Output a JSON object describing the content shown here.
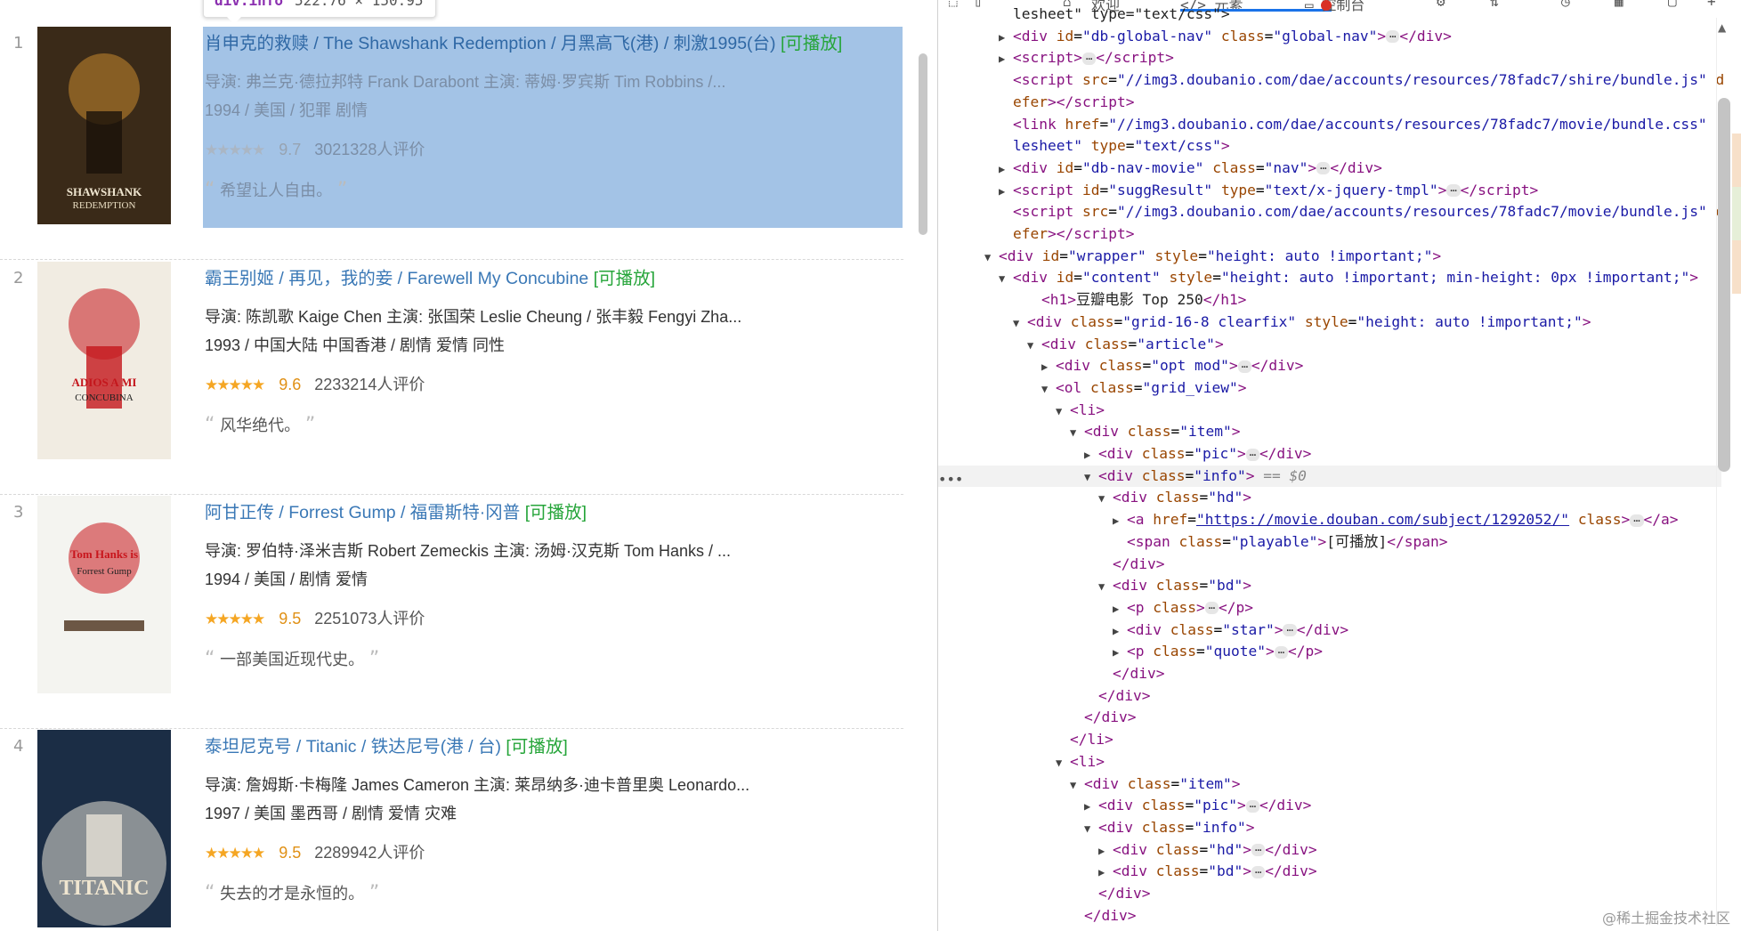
{
  "tooltip": {
    "tag": "div.info",
    "dims": "522.76 × 150.95"
  },
  "movies": [
    {
      "rank": "1",
      "title": "肖申克的救赎",
      "other": " / The Shawshank Redemption  / 月黑高飞(港) / 刺激1995(台)",
      "playable": "[可播放]",
      "director": "导演: 弗兰克·德拉邦特 Frank Darabont   主演: 蒂姆·罗宾斯 Tim Robbins /...",
      "meta": "1994 / 美国 / 犯罪 剧情",
      "stars": "★★★★★",
      "score": "9.7",
      "count": "3021328人评价",
      "quote": "希望让人自由。",
      "poster": {
        "label": "SHAWSHANK",
        "sub": "REDEMPTION",
        "bg": "#3a2a18",
        "accent": "#c7892f"
      }
    },
    {
      "rank": "2",
      "title": "霸王别姬",
      "other": " / 再见，我的妾 / Farewell My Concubine",
      "playable": "[可播放]",
      "director": "导演: 陈凯歌 Kaige Chen   主演: 张国荣 Leslie Cheung / 张丰毅 Fengyi Zha...",
      "meta": "1993 / 中国大陆 中国香港 / 剧情 爱情 同性",
      "stars": "★★★★★",
      "score": "9.6",
      "count": "2233214人评价",
      "quote": "风华绝代。",
      "poster": {
        "label": "ADIOS A MI",
        "sub": "CONCUBINA",
        "bg": "#f1ece2",
        "accent": "#c4161c"
      }
    },
    {
      "rank": "3",
      "title": "阿甘正传",
      "other": " / Forrest Gump  / 福雷斯特·冈普",
      "playable": "[可播放]",
      "director": "导演: 罗伯特·泽米吉斯 Robert Zemeckis   主演: 汤姆·汉克斯 Tom Hanks / ...",
      "meta": "1994 / 美国 / 剧情 爱情",
      "stars": "★★★★★",
      "score": "9.5",
      "count": "2251073人评价",
      "quote": "一部美国近现代史。",
      "poster": {
        "label": "Tom Hanks is",
        "sub": "Forrest Gump",
        "bg": "#f4f4f0",
        "accent": "#c8151c"
      }
    },
    {
      "rank": "4",
      "title": "泰坦尼克号",
      "other": " / Titanic  / 铁达尼号(港 / 台)",
      "playable": "[可播放]",
      "director": "导演: 詹姆斯·卡梅隆 James Cameron   主演: 莱昂纳多·迪卡普里奥 Leonardo...",
      "meta": "1997 / 美国 墨西哥 / 剧情 爱情 灾难",
      "stars": "★★★★★",
      "score": "9.5",
      "count": "2289942人评价",
      "quote": "失去的才是永恒的。",
      "poster": {
        "label": "TITANIC",
        "sub": "",
        "bg": "#1b2d45",
        "accent": "#e6e1d6"
      }
    }
  ],
  "devtools": {
    "toolbar": [
      "元素",
      "控制台"
    ],
    "lines": [
      {
        "indent": 4,
        "tri": "",
        "html": "<span class='tx'>lesheet\" type=\"text/css\"></span>"
      },
      {
        "indent": 4,
        "tri": "▶",
        "html": "<span class='tg'>&lt;div</span> <span class='an'>id</span>=<span class='av'>\"db-global-nav\"</span> <span class='an'>class</span>=<span class='av'>\"global-nav\"</span><span class='tg'>&gt;</span><span class='ell'>⋯</span><span class='tg'>&lt;/div&gt;</span>"
      },
      {
        "indent": 4,
        "tri": "▶",
        "html": "<span class='tg'>&lt;script&gt;</span><span class='ell'>⋯</span><span class='tg'>&lt;/script&gt;</span>"
      },
      {
        "indent": 4,
        "tri": "",
        "html": "<span class='tg'>&lt;script</span> <span class='an'>src</span>=<span class='av'>\"//img3.doubanio.com/dae/accounts/resources/78fadc7/shire/bundle.js\"</span> <span class='an'>d</span>"
      },
      {
        "indent": 4,
        "tri": "",
        "html": "<span class='an'>efer</span><span class='tg'>&gt;&lt;/script&gt;</span>"
      },
      {
        "indent": 4,
        "tri": "",
        "html": "<span class='tg'>&lt;link</span> <span class='an'>href</span>=<span class='av'>\"//img3.doubanio.com/dae/accounts/resources/78fadc7/movie/bundle.css\"</span> <span class='an'>r</span>"
      },
      {
        "indent": 4,
        "tri": "",
        "html": "<span class='av'>lesheet\"</span> <span class='an'>type</span>=<span class='av'>\"text/css\"</span><span class='tg'>&gt;</span>"
      },
      {
        "indent": 4,
        "tri": "▶",
        "html": "<span class='tg'>&lt;div</span> <span class='an'>id</span>=<span class='av'>\"db-nav-movie\"</span> <span class='an'>class</span>=<span class='av'>\"nav\"</span><span class='tg'>&gt;</span><span class='ell'>⋯</span><span class='tg'>&lt;/div&gt;</span>"
      },
      {
        "indent": 4,
        "tri": "▶",
        "html": "<span class='tg'>&lt;script</span> <span class='an'>id</span>=<span class='av'>\"suggResult\"</span> <span class='an'>type</span>=<span class='av'>\"text/x-jquery-tmpl\"</span><span class='tg'>&gt;</span><span class='ell'>⋯</span><span class='tg'>&lt;/script&gt;</span>"
      },
      {
        "indent": 4,
        "tri": "",
        "html": "<span class='tg'>&lt;script</span> <span class='an'>src</span>=<span class='av'>\"//img3.doubanio.com/dae/accounts/resources/78fadc7/movie/bundle.js\"</span> <span class='an'>d</span>"
      },
      {
        "indent": 4,
        "tri": "",
        "html": "<span class='an'>efer</span><span class='tg'>&gt;&lt;/script&gt;</span>"
      },
      {
        "indent": 3,
        "tri": "▼",
        "html": "<span class='tg'>&lt;div</span> <span class='an'>id</span>=<span class='av'>\"wrapper\"</span> <span class='an'>style</span>=<span class='av'>\"height: auto !important;\"</span><span class='tg'>&gt;</span>"
      },
      {
        "indent": 4,
        "tri": "▼",
        "html": "<span class='tg'>&lt;div</span> <span class='an'>id</span>=<span class='av'>\"content\"</span> <span class='an'>style</span>=<span class='av'>\"height: auto !important; min-height: 0px !important;\"</span><span class='tg'>&gt;</span>"
      },
      {
        "indent": 6,
        "tri": "",
        "html": "<span class='tg'>&lt;h1&gt;</span><span class='tx'>豆瓣电影 Top 250</span><span class='tg'>&lt;/h1&gt;</span>"
      },
      {
        "indent": 5,
        "tri": "▼",
        "html": "<span class='tg'>&lt;div</span> <span class='an'>class</span>=<span class='av'>\"grid-16-8 clearfix\"</span> <span class='an'>style</span>=<span class='av'>\"height: auto !important;\"</span><span class='tg'>&gt;</span>"
      },
      {
        "indent": 6,
        "tri": "▼",
        "html": "<span class='tg'>&lt;div</span> <span class='an'>class</span>=<span class='av'>\"article\"</span><span class='tg'>&gt;</span>"
      },
      {
        "indent": 7,
        "tri": "▶",
        "html": "<span class='tg'>&lt;div</span> <span class='an'>class</span>=<span class='av'>\"opt mod\"</span><span class='tg'>&gt;</span><span class='ell'>⋯</span><span class='tg'>&lt;/div&gt;</span>"
      },
      {
        "indent": 7,
        "tri": "▼",
        "html": "<span class='tg'>&lt;ol</span> <span class='an'>class</span>=<span class='av'>\"grid_view\"</span><span class='tg'>&gt;</span>"
      },
      {
        "indent": 8,
        "tri": "▼",
        "html": "<span class='tg'>&lt;li&gt;</span>"
      },
      {
        "indent": 9,
        "tri": "▼",
        "html": "<span class='tg'>&lt;div</span> <span class='an'>class</span>=<span class='av'>\"item\"</span><span class='tg'>&gt;</span>"
      },
      {
        "indent": 10,
        "tri": "▶",
        "html": "<span class='tg'>&lt;div</span> <span class='an'>class</span>=<span class='av'>\"pic\"</span><span class='tg'>&gt;</span><span class='ell'>⋯</span><span class='tg'>&lt;/div&gt;</span>"
      },
      {
        "indent": 10,
        "tri": "▼",
        "cur": true,
        "html": "<span class='tg'>&lt;div</span> <span class='an'>class</span>=<span class='av'>\"info\"</span><span class='tg'>&gt;</span> <span class='dollar'>== $0</span>"
      },
      {
        "indent": 11,
        "tri": "▼",
        "html": "<span class='tg'>&lt;div</span> <span class='an'>class</span>=<span class='av'>\"hd\"</span><span class='tg'>&gt;</span>"
      },
      {
        "indent": 12,
        "tri": "▶",
        "html": "<span class='tg'>&lt;a</span> <span class='an'>href</span>=<span class='lnk'>\"https://movie.douban.com/subject/1292052/\"</span> <span class='an'>class</span><span class='tg'>&gt;</span><span class='ell'>⋯</span><span class='tg'>&lt;/a&gt;</span>"
      },
      {
        "indent": 12,
        "tri": "",
        "html": "<span class='tg'>&lt;span</span> <span class='an'>class</span>=<span class='av'>\"playable\"</span><span class='tg'>&gt;</span><span class='tx'>[可播放]</span><span class='tg'>&lt;/span&gt;</span>"
      },
      {
        "indent": 11,
        "tri": "",
        "html": "<span class='tg'>&lt;/div&gt;</span>"
      },
      {
        "indent": 11,
        "tri": "▼",
        "html": "<span class='tg'>&lt;div</span> <span class='an'>class</span>=<span class='av'>\"bd\"</span><span class='tg'>&gt;</span>"
      },
      {
        "indent": 12,
        "tri": "▶",
        "html": "<span class='tg'>&lt;p</span> <span class='an'>class</span><span class='tg'>&gt;</span><span class='ell'>⋯</span><span class='tg'>&lt;/p&gt;</span>"
      },
      {
        "indent": 12,
        "tri": "▶",
        "html": "<span class='tg'>&lt;div</span> <span class='an'>class</span>=<span class='av'>\"star\"</span><span class='tg'>&gt;</span><span class='ell'>⋯</span><span class='tg'>&lt;/div&gt;</span>"
      },
      {
        "indent": 12,
        "tri": "▶",
        "html": "<span class='tg'>&lt;p</span> <span class='an'>class</span>=<span class='av'>\"quote\"</span><span class='tg'>&gt;</span><span class='ell'>⋯</span><span class='tg'>&lt;/p&gt;</span>"
      },
      {
        "indent": 11,
        "tri": "",
        "html": "<span class='tg'>&lt;/div&gt;</span>"
      },
      {
        "indent": 10,
        "tri": "",
        "html": "<span class='tg'>&lt;/div&gt;</span>"
      },
      {
        "indent": 9,
        "tri": "",
        "html": "<span class='tg'>&lt;/div&gt;</span>"
      },
      {
        "indent": 8,
        "tri": "",
        "html": "<span class='tg'>&lt;/li&gt;</span>"
      },
      {
        "indent": 8,
        "tri": "▼",
        "html": "<span class='tg'>&lt;li&gt;</span>"
      },
      {
        "indent": 9,
        "tri": "▼",
        "html": "<span class='tg'>&lt;div</span> <span class='an'>class</span>=<span class='av'>\"item\"</span><span class='tg'>&gt;</span>"
      },
      {
        "indent": 10,
        "tri": "▶",
        "html": "<span class='tg'>&lt;div</span> <span class='an'>class</span>=<span class='av'>\"pic\"</span><span class='tg'>&gt;</span><span class='ell'>⋯</span><span class='tg'>&lt;/div&gt;</span>"
      },
      {
        "indent": 10,
        "tri": "▼",
        "html": "<span class='tg'>&lt;div</span> <span class='an'>class</span>=<span class='av'>\"info\"</span><span class='tg'>&gt;</span>"
      },
      {
        "indent": 11,
        "tri": "▶",
        "html": "<span class='tg'>&lt;div</span> <span class='an'>class</span>=<span class='av'>\"hd\"</span><span class='tg'>&gt;</span><span class='ell'>⋯</span><span class='tg'>&lt;/div&gt;</span>"
      },
      {
        "indent": 11,
        "tri": "▶",
        "html": "<span class='tg'>&lt;div</span> <span class='an'>class</span>=<span class='av'>\"bd\"</span><span class='tg'>&gt;</span><span class='ell'>⋯</span><span class='tg'>&lt;/div&gt;</span>"
      },
      {
        "indent": 10,
        "tri": "",
        "html": "<span class='tg'>&lt;/div&gt;</span>"
      },
      {
        "indent": 9,
        "tri": "",
        "html": "<span class='tg'>&lt;/div&gt;</span>"
      }
    ]
  },
  "watermark": "@稀土掘金技术社区",
  "colors": {
    "selection": "#a3c3e6",
    "link": "#3a78b6",
    "playable": "#26a53a",
    "star": "#f5a623",
    "arrow": "#8ccc1e"
  }
}
